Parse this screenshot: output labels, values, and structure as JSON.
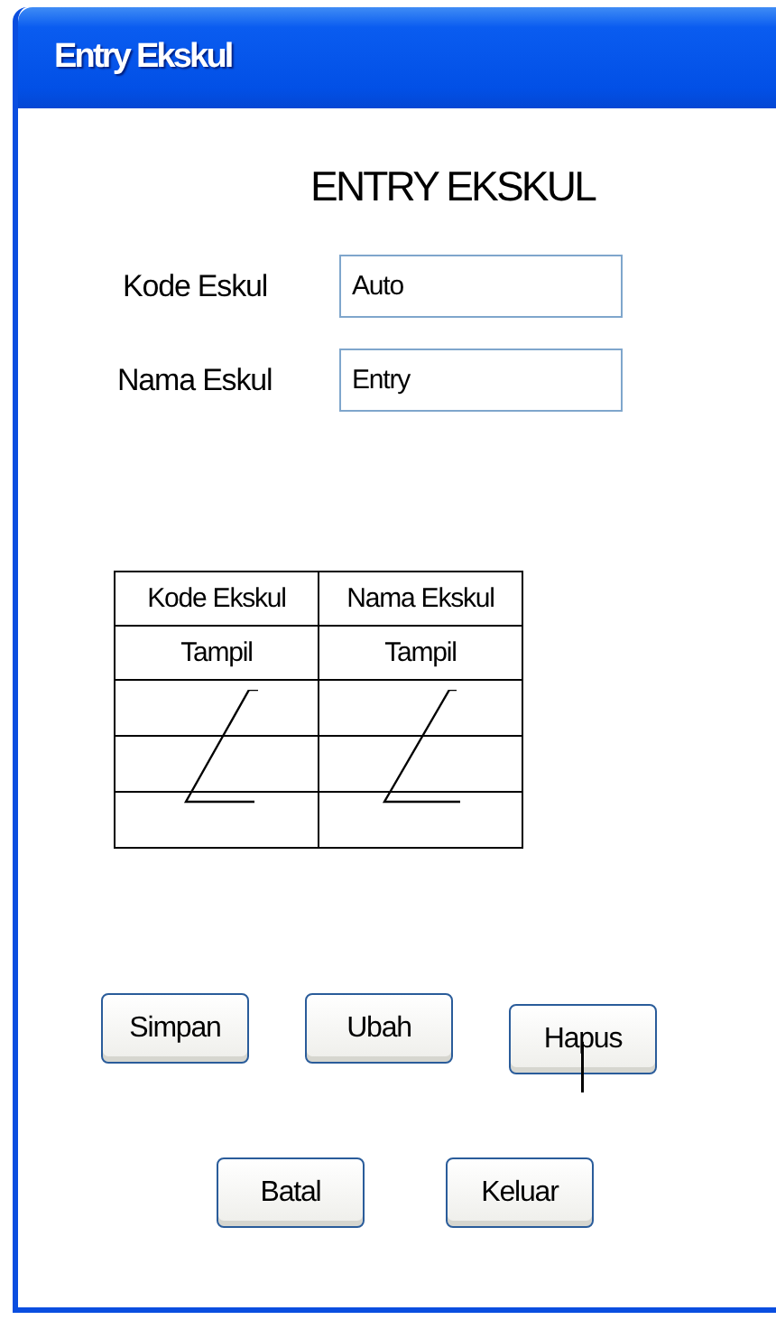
{
  "window": {
    "title": "Entry Ekskul"
  },
  "heading": "ENTRY EKSKUL",
  "fields": [
    {
      "label": "Kode Eskul",
      "value": "Auto"
    },
    {
      "label": "Nama Eskul",
      "value": "Entry"
    }
  ],
  "table": {
    "columns": [
      "Kode Ekskul",
      "Nama Ekskul"
    ],
    "action_row": [
      "Tampil",
      "Tampil"
    ]
  },
  "buttons": [
    {
      "label": "Simpan"
    },
    {
      "label": "Ubah"
    },
    {
      "label": "Hapus"
    },
    {
      "label": "Batal"
    },
    {
      "label": "Keluar"
    }
  ]
}
